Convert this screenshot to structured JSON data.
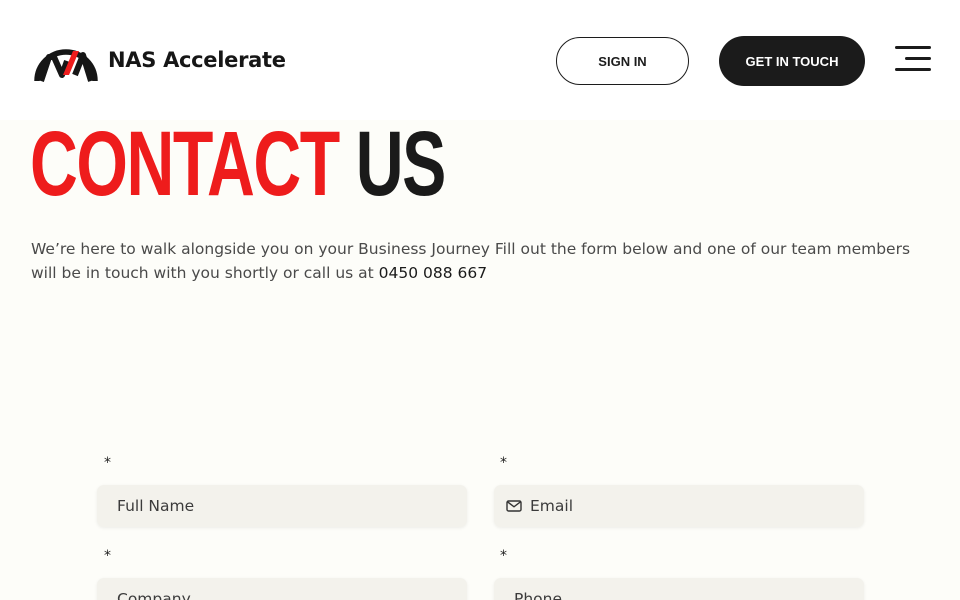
{
  "header": {
    "logo_text": "NAS Accelerate",
    "signin_label": "SIGN IN",
    "get_in_touch_label": "GET IN TOUCH"
  },
  "hero": {
    "title_part1": "CONTACT",
    "title_part2": "US",
    "intro_text": "We’re here to walk alongside you on your Business Journey Fill out the form below and one of our team members will be in touch with you shortly or call us at ",
    "phone": "0450 088 667"
  },
  "form": {
    "required_marker": "*",
    "full_name_placeholder": "Full Name",
    "email_placeholder": "Email",
    "company_placeholder": "Company",
    "phone_placeholder": "Phone"
  },
  "colors": {
    "accent_red": "#ee1c1c",
    "dark": "#1b1b1b",
    "field_bg": "#f3f2ec"
  },
  "icons": [
    "nas-logo-icon",
    "hamburger-menu-icon",
    "mail-icon"
  ]
}
